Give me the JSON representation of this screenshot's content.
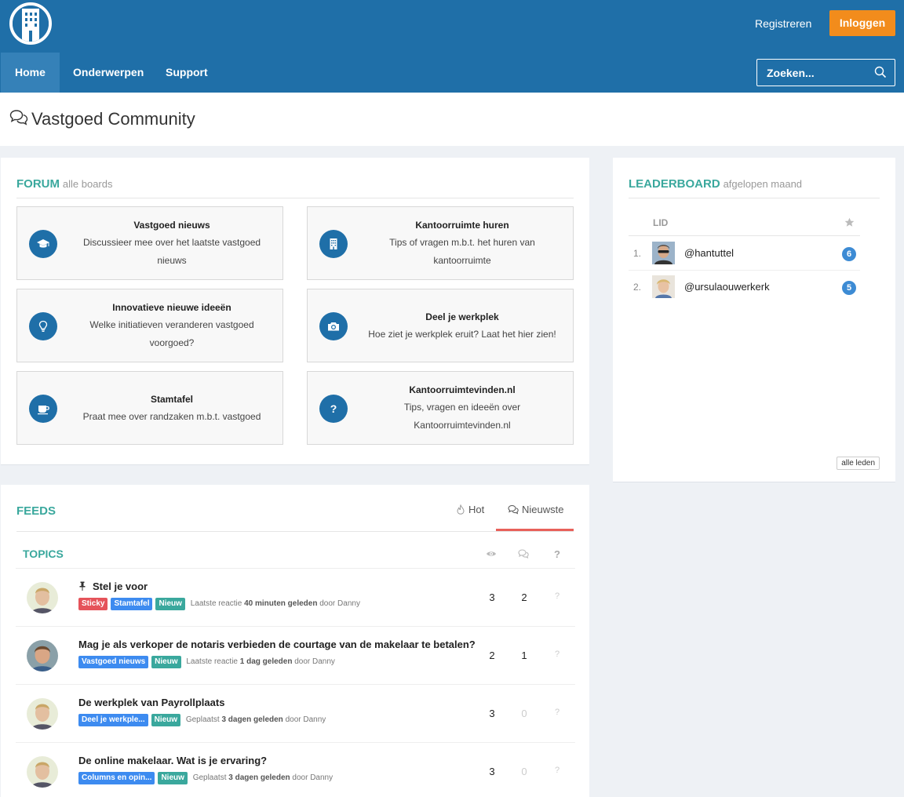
{
  "header": {
    "register": "Registreren",
    "login": "Inloggen",
    "nav": [
      {
        "label": "Home"
      },
      {
        "label": "Onderwerpen"
      },
      {
        "label": "Support"
      }
    ],
    "search_placeholder": "Zoeken..."
  },
  "page": {
    "title": "Vastgoed Community"
  },
  "forum": {
    "title": "FORUM",
    "subtitle": "alle boards",
    "boards": [
      {
        "title": "Vastgoed nieuws",
        "desc": "Discussieer mee over het laatste vastgoed nieuws",
        "icon": "graduation-cap-icon"
      },
      {
        "title": "Kantoorruimte huren",
        "desc": "Tips of vragen m.b.t. het huren van kantoorruimte",
        "icon": "building-icon"
      },
      {
        "title": "Innovatieve nieuwe ideeën",
        "desc": "Welke initiatieven veranderen vastgoed voorgoed?",
        "icon": "lightbulb-icon"
      },
      {
        "title": "Deel je werkplek",
        "desc": "Hoe ziet je werkplek eruit? Laat het hier zien!",
        "icon": "camera-icon"
      },
      {
        "title": "Stamtafel",
        "desc": "Praat mee over randzaken m.b.t. vastgoed",
        "icon": "coffee-icon"
      },
      {
        "title": "Kantoorruimtevinden.nl",
        "desc": "Tips, vragen en ideeën over Kantoorruimtevinden.nl",
        "icon": "question-icon"
      }
    ]
  },
  "leaderboard": {
    "title": "LEADERBOARD",
    "subtitle": "afgelopen maand",
    "col_member": "LID",
    "rows": [
      {
        "rank": "1.",
        "name": "@hantuttel",
        "count": "6"
      },
      {
        "rank": "2.",
        "name": "@ursulaouwerkerk",
        "count": "5"
      }
    ],
    "all_button": "alle leden"
  },
  "feeds": {
    "title": "FEEDS",
    "tabs": [
      {
        "label": "Hot"
      },
      {
        "label": "Nieuwste"
      }
    ],
    "active_tab": "Nieuwste",
    "topics_label": "TOPICS",
    "topics": [
      {
        "title": "Stel je voor",
        "pinned": true,
        "tags": [
          {
            "label": "Sticky",
            "color": "red"
          },
          {
            "label": "Stamtafel",
            "color": "blue"
          },
          {
            "label": "Nieuw",
            "color": "teal"
          }
        ],
        "meta_prefix": "Laatste reactie",
        "meta_time": "40 minuten geleden",
        "meta_suffix": "door Danny",
        "views": "3",
        "replies": "2",
        "question": "?"
      },
      {
        "title": "Mag je als verkoper de notaris verbieden de courtage van de makelaar te betalen?",
        "pinned": false,
        "tags": [
          {
            "label": "Vastgoed nieuws",
            "color": "blue"
          },
          {
            "label": "Nieuw",
            "color": "teal"
          }
        ],
        "meta_prefix": "Laatste reactie",
        "meta_time": "1 dag geleden",
        "meta_suffix": "door Danny",
        "views": "2",
        "replies": "1",
        "question": "?"
      },
      {
        "title": "De werkplek van Payrollplaats",
        "pinned": false,
        "tags": [
          {
            "label": "Deel je werkple...",
            "color": "blue"
          },
          {
            "label": "Nieuw",
            "color": "teal"
          }
        ],
        "meta_prefix": "Geplaatst",
        "meta_time": "3 dagen geleden",
        "meta_suffix": "door Danny",
        "views": "3",
        "replies": "0",
        "question": "?"
      },
      {
        "title": "De online makelaar. Wat is je ervaring?",
        "pinned": false,
        "tags": [
          {
            "label": "Columns en opin...",
            "color": "blue"
          },
          {
            "label": "Nieuw",
            "color": "teal"
          }
        ],
        "meta_prefix": "Geplaatst",
        "meta_time": "3 dagen geleden",
        "meta_suffix": "door Danny",
        "views": "3",
        "replies": "0",
        "question": "?"
      }
    ]
  },
  "colors": {
    "header_blue": "#1f6fa8",
    "login_orange": "#f28c1c",
    "accent_teal": "#3aa89d",
    "tab_underline": "#e8605a"
  }
}
